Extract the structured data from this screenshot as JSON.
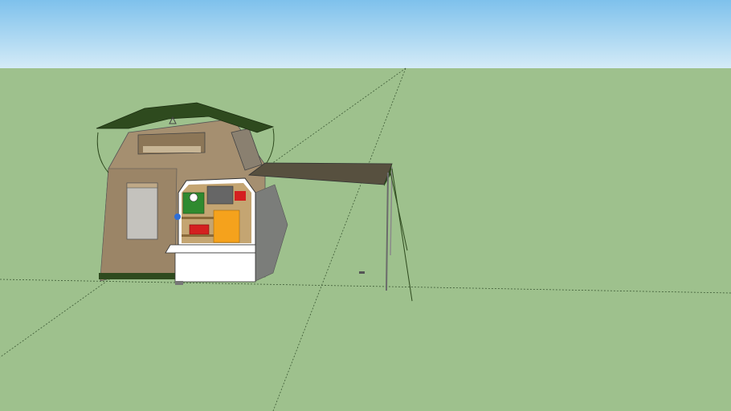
{
  "scene": {
    "type": "3d-model-viewport",
    "subject": "trailer-with-rooftop-tent-and-awning",
    "colors": {
      "sky_top": "#7ec1ec",
      "sky_bottom": "#d4ebf7",
      "ground": "#9ec18d",
      "tent_canvas": "#a58f70",
      "tent_cover": "#2e4a1e",
      "awning": "#57503f",
      "trailer_body": "#ffffff",
      "storage_orange": "#f5a21c",
      "fridge_green": "#2f8a2f",
      "toolbox_red": "#d42020",
      "axis_line": "#3d5a35"
    },
    "icons": [
      "triangle-logo-icon"
    ]
  }
}
